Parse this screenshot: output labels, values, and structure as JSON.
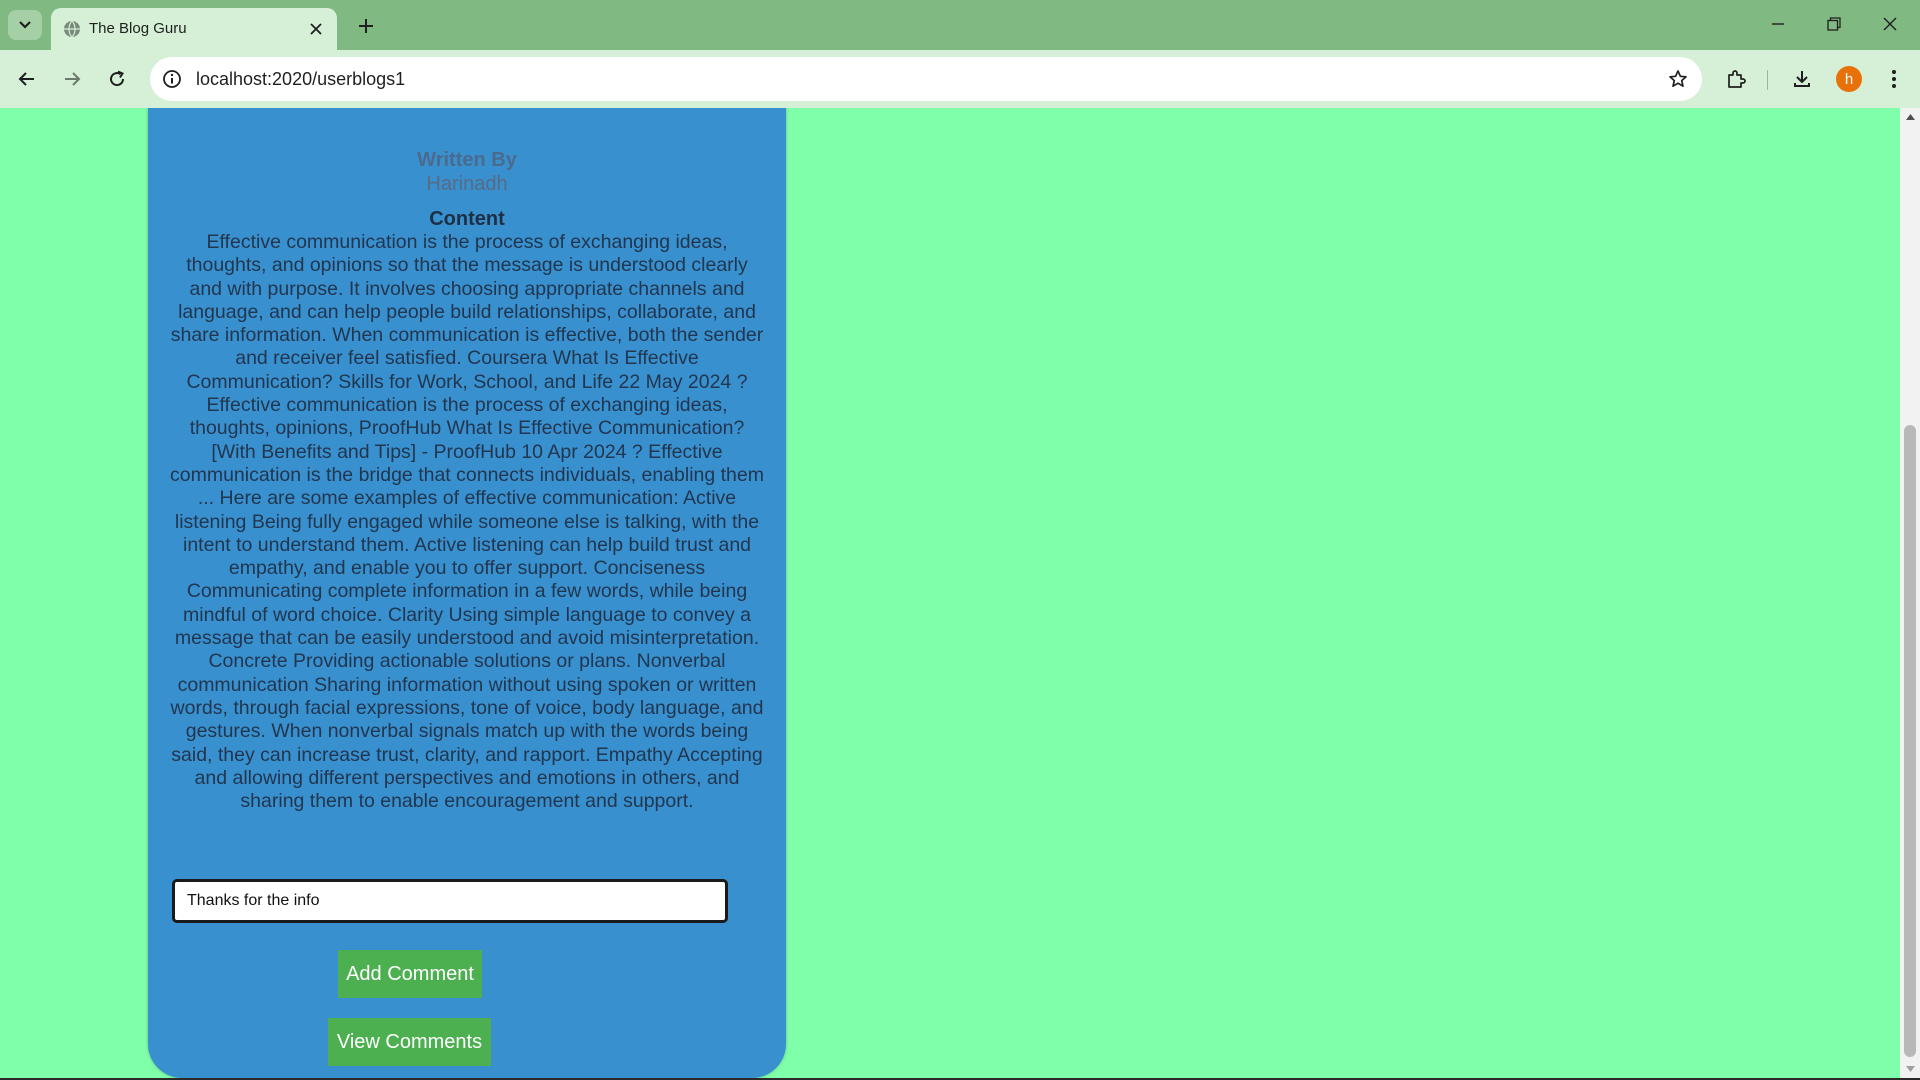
{
  "browser": {
    "tab_title": "The Blog Guru",
    "url": "localhost:2020/userblogs1",
    "profile_initial": "h",
    "icons": {
      "tab_search": "chevron-down-icon",
      "tab_favicon": "globe-icon",
      "tab_close": "close-icon",
      "new_tab": "plus-icon",
      "minimize": "minimize-icon",
      "restore": "restore-icon",
      "close_window": "close-icon",
      "back": "back-arrow-icon",
      "forward": "forward-arrow-icon",
      "reload": "reload-icon",
      "site_info": "info-icon",
      "bookmark": "star-icon",
      "extensions": "puzzle-icon",
      "downloads": "download-icon",
      "menu": "kebab-menu-icon"
    }
  },
  "blog": {
    "written_by_label": "Written By",
    "author": "Harinadh",
    "content_label": "Content",
    "content": "Effective communication is the process of exchanging ideas, thoughts, and opinions so that the message is understood clearly and with purpose. It involves choosing appropriate channels and language, and can help people build relationships, collaborate, and share information. When communication is effective, both the sender and receiver feel satisfied. Coursera What Is Effective Communication? Skills for Work, School, and Life 22 May 2024 ? Effective communication is the process of exchanging ideas, thoughts, opinions, ProofHub What Is Effective Communication? [With Benefits and Tips] - ProofHub 10 Apr 2024 ? Effective communication is the bridge that connects individuals, enabling them ... Here are some examples of effective communication: Active listening Being fully engaged while someone else is talking, with the intent to understand them. Active listening can help build trust and empathy, and enable you to offer support. Conciseness Communicating complete information in a few words, while being mindful of word choice. Clarity Using simple language to convey a message that can be easily understood and avoid misinterpretation. Concrete Providing actionable solutions or plans. Nonverbal communication Sharing information without using spoken or written words, through facial expressions, tone of voice, body language, and gestures. When nonverbal signals match up with the words being said, they can increase trust, clarity, and rapport. Empathy Accepting and allowing different perspectives and emotions in others, and sharing them to enable encouragement and support."
  },
  "comment": {
    "input_value": "Thanks for the info",
    "add_button": "Add Comment",
    "view_button": "View Comments"
  },
  "colors": {
    "page_bg": "#80ffaa",
    "card_bg": "#3890cf",
    "button_bg": "#4caf50",
    "chrome_bg": "#80b981"
  }
}
